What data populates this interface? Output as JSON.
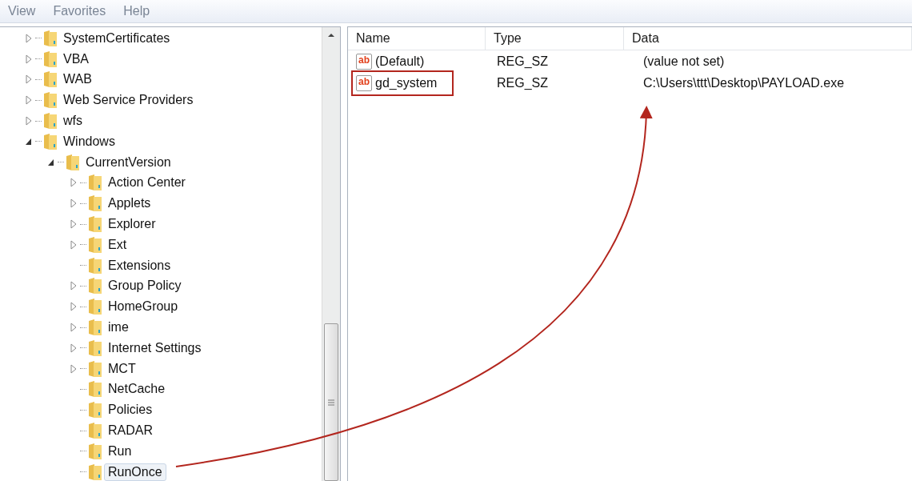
{
  "menu": [
    "View",
    "Favorites",
    "Help"
  ],
  "tree": [
    {
      "label": "SystemCertificates",
      "has_children": true,
      "expanded": false,
      "selected": false
    },
    {
      "label": "VBA",
      "has_children": true,
      "expanded": false,
      "selected": false
    },
    {
      "label": "WAB",
      "has_children": true,
      "expanded": false,
      "selected": false
    },
    {
      "label": "Web Service Providers",
      "has_children": true,
      "expanded": false,
      "selected": false
    },
    {
      "label": "wfs",
      "has_children": true,
      "expanded": false,
      "selected": false
    },
    {
      "label": "Windows",
      "has_children": true,
      "expanded": true,
      "selected": false,
      "children": [
        {
          "label": "CurrentVersion",
          "has_children": true,
          "expanded": true,
          "selected": false,
          "children": [
            {
              "label": "Action Center",
              "has_children": true,
              "expanded": false,
              "selected": false
            },
            {
              "label": "Applets",
              "has_children": true,
              "expanded": false,
              "selected": false
            },
            {
              "label": "Explorer",
              "has_children": true,
              "expanded": false,
              "selected": false
            },
            {
              "label": "Ext",
              "has_children": true,
              "expanded": false,
              "selected": false
            },
            {
              "label": "Extensions",
              "has_children": false,
              "selected": false
            },
            {
              "label": "Group Policy",
              "has_children": true,
              "expanded": false,
              "selected": false
            },
            {
              "label": "HomeGroup",
              "has_children": true,
              "expanded": false,
              "selected": false
            },
            {
              "label": "ime",
              "has_children": true,
              "expanded": false,
              "selected": false
            },
            {
              "label": "Internet Settings",
              "has_children": true,
              "expanded": false,
              "selected": false
            },
            {
              "label": "MCT",
              "has_children": true,
              "expanded": false,
              "selected": false
            },
            {
              "label": "NetCache",
              "has_children": false,
              "selected": false
            },
            {
              "label": "Policies",
              "has_children": false,
              "selected": false
            },
            {
              "label": "RADAR",
              "has_children": false,
              "selected": false
            },
            {
              "label": "Run",
              "has_children": false,
              "selected": false
            },
            {
              "label": "RunOnce",
              "has_children": false,
              "selected": true
            }
          ]
        }
      ]
    }
  ],
  "values": {
    "columns": [
      "Name",
      "Type",
      "Data"
    ],
    "rows": [
      {
        "icon_text": "ab",
        "name": "(Default)",
        "type": "REG_SZ",
        "data": "(value not set)",
        "highlighted": false
      },
      {
        "icon_text": "ab",
        "name": "gd_system",
        "type": "REG_SZ",
        "data": "C:\\Users\\ttt\\Desktop\\PAYLOAD.exe",
        "highlighted": true
      }
    ]
  }
}
